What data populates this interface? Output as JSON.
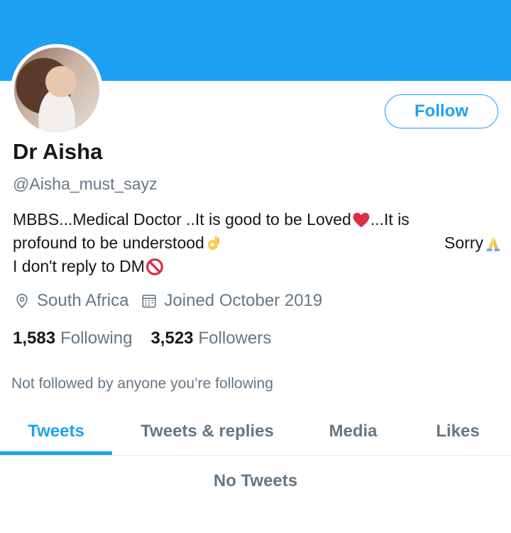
{
  "profile": {
    "name": "Dr Aisha",
    "handle": "@Aisha_must_sayz",
    "follow_label": "Follow",
    "bio": {
      "line1": "MBBS...Medical Doctor ..It is good to be Loved",
      "line1_after": "...It is",
      "line2_left": "profound to be understood ",
      "line2_right": "Sorry ",
      "line3": "I don't reply to DM"
    },
    "location": "South Africa",
    "joined": "Joined October 2019",
    "following_count": "1,583",
    "following_label": "Following",
    "followers_count": "3,523",
    "followers_label": "Followers",
    "not_followed_text": "Not followed by anyone you’re following"
  },
  "tabs": [
    {
      "label": "Tweets",
      "active": true
    },
    {
      "label": "Tweets & replies",
      "active": false
    },
    {
      "label": "Media",
      "active": false
    },
    {
      "label": "Likes",
      "active": false
    }
  ],
  "feed": {
    "empty_text": "No Tweets"
  },
  "colors": {
    "accent": "#1da1f2",
    "secondary_text": "#657786",
    "primary_text": "#14171a"
  },
  "icons": [
    "location-pin-icon",
    "calendar-icon",
    "red-heart-emoji-icon",
    "ok-hand-emoji-icon",
    "folded-hands-emoji-icon",
    "prohibited-emoji-icon"
  ]
}
